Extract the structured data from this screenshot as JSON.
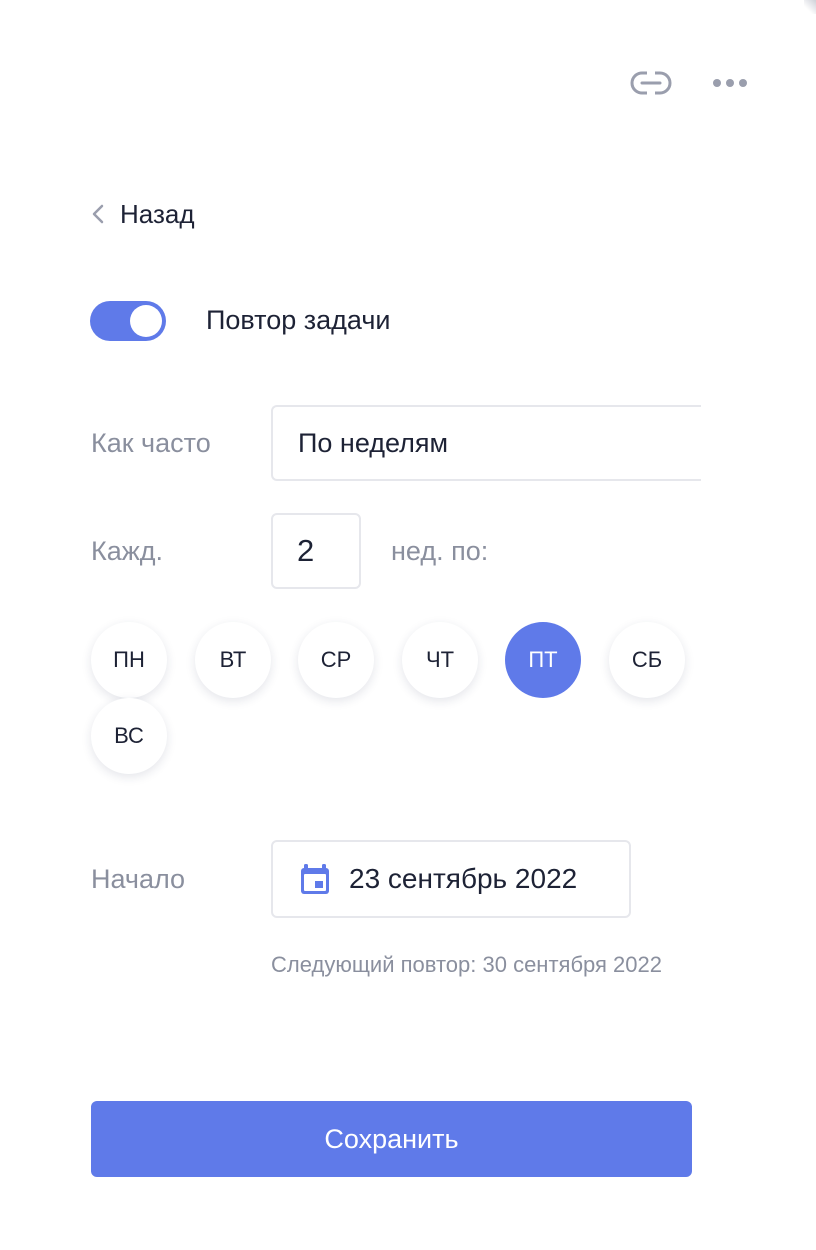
{
  "colors": {
    "accent": "#5f7ae9",
    "text": "#1d2235",
    "muted": "#8a8f9e",
    "border": "#e6e7ec",
    "icon_gray": "#9a9ead"
  },
  "toolbar": {
    "link_icon": "link-icon",
    "more_icon": "more-horizontal-icon"
  },
  "back": {
    "label": "Назад",
    "icon": "chevron-left-icon"
  },
  "repeat_toggle": {
    "label": "Повтор задачи",
    "on": true
  },
  "frequency": {
    "label": "Как часто",
    "value": "По неделям"
  },
  "interval": {
    "label": "Кажд.",
    "value": "2",
    "suffix": "нед. по:"
  },
  "weekdays": {
    "items": [
      {
        "label": "ПН",
        "selected": false
      },
      {
        "label": "ВТ",
        "selected": false
      },
      {
        "label": "СР",
        "selected": false
      },
      {
        "label": "ЧТ",
        "selected": false
      },
      {
        "label": "ПТ",
        "selected": true
      },
      {
        "label": "СБ",
        "selected": false
      },
      {
        "label": "ВС",
        "selected": false
      }
    ]
  },
  "start": {
    "label": "Начало",
    "icon": "calendar-icon",
    "value": "23 сентябрь 2022",
    "next_repeat": "Следующий повтор: 30 сентября 2022"
  },
  "save_label": "Сохранить"
}
